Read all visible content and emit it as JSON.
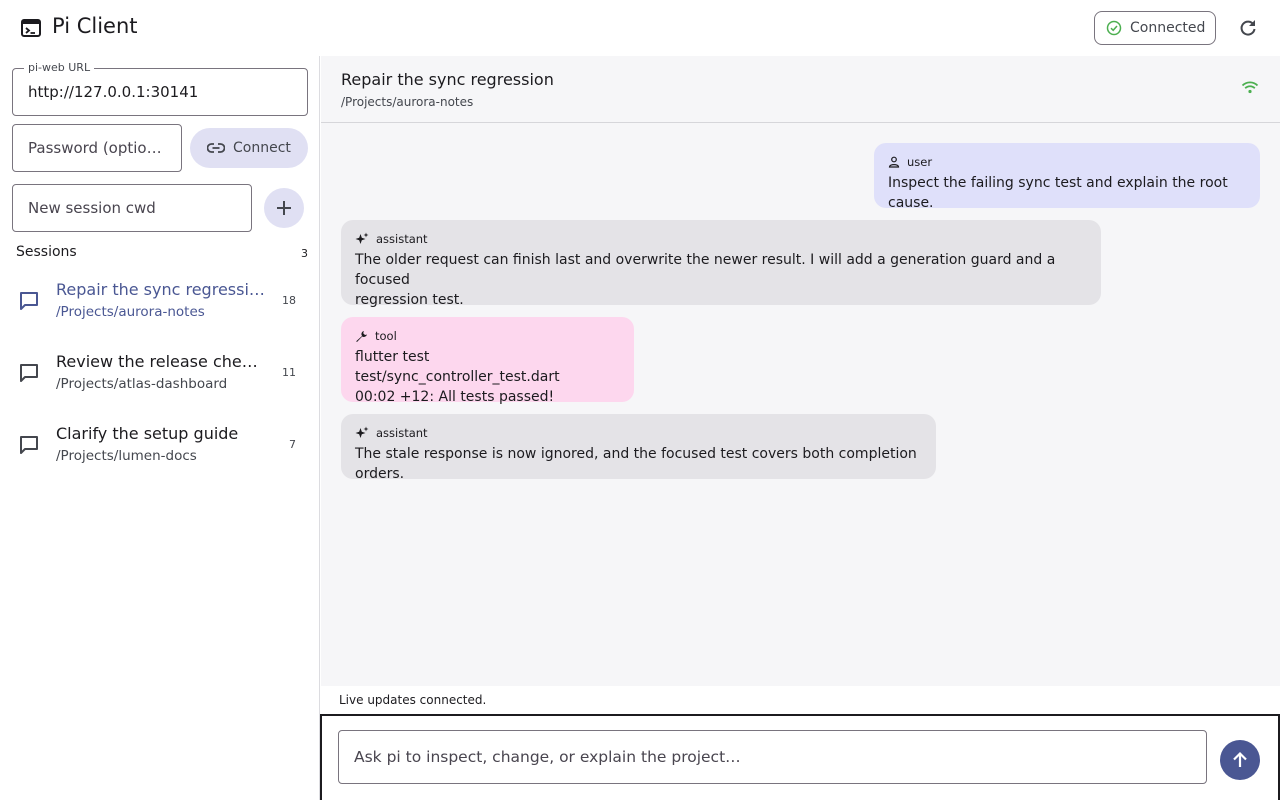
{
  "app": {
    "title": "Pi Client"
  },
  "status": {
    "label": "Connected"
  },
  "sidebar": {
    "url_label": "pi-web URL",
    "url_value": "http://127.0.0.1:30141",
    "password_placeholder": "Password (optio…",
    "connect_label": "Connect",
    "cwd_placeholder": "New session cwd",
    "sessions_title": "Sessions",
    "sessions_count": "3",
    "sessions": [
      {
        "title": "Repair the sync regression",
        "path": "/Projects/aurora-notes",
        "count": "18"
      },
      {
        "title": "Review the release checkl…",
        "path": "/Projects/atlas-dashboard",
        "count": "11"
      },
      {
        "title": "Clarify the setup guide",
        "path": "/Projects/lumen-docs",
        "count": "7"
      }
    ]
  },
  "main": {
    "title": "Repair the sync regression",
    "path": "/Projects/aurora-notes",
    "messages": [
      {
        "role": "user",
        "text": "Inspect the failing sync test and explain the root cause."
      },
      {
        "role": "assistant",
        "text": "The older request can finish last and overwrite the newer result. I will add a generation guard and a focused\nregression test."
      },
      {
        "role": "tool",
        "text": "flutter test test/sync_controller_test.dart\n00:02 +12: All tests passed!"
      },
      {
        "role": "assistant",
        "text": "The stale response is now ignored, and the focused test covers both completion orders."
      }
    ],
    "live_status": "Live updates connected.",
    "composer_placeholder": "Ask pi to inspect, change, or explain the project…"
  },
  "colors": {
    "accent": "#4a5793",
    "user_bubble": "#dfe0fa",
    "assistant_bubble": "#e4e3e7",
    "tool_bubble": "#fdd7ee",
    "connected_green": "#4caf50"
  },
  "icons": {
    "app": "terminal-icon",
    "status": "check-circle-icon",
    "refresh": "refresh-icon",
    "connect": "link-icon",
    "add": "plus-icon",
    "session": "chat-bubble-icon",
    "live": "wifi-icon",
    "user": "person-icon",
    "assistant": "sparkle-icon",
    "tool": "wrench-icon",
    "send": "arrow-up-icon"
  }
}
